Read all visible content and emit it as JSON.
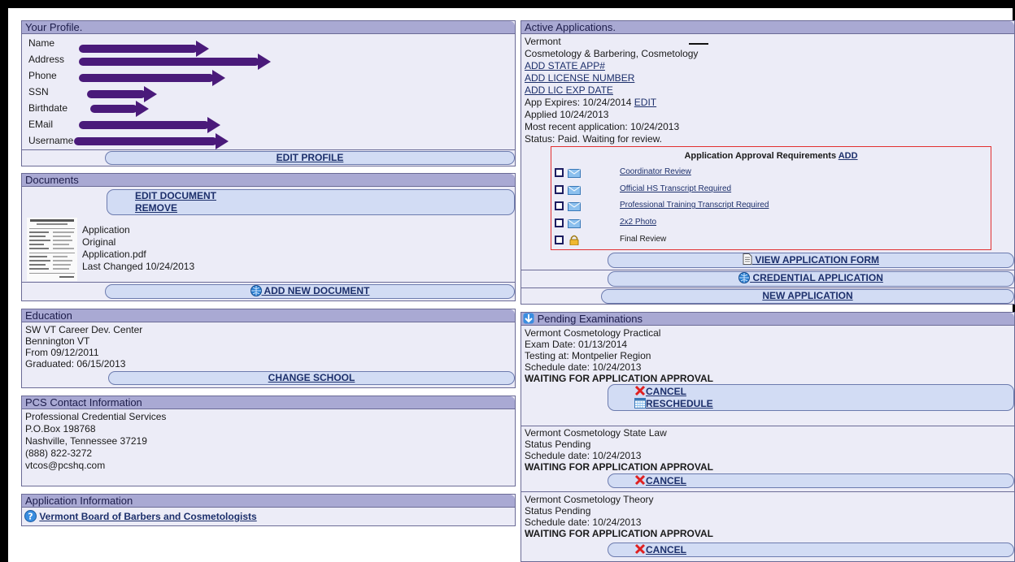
{
  "profile": {
    "title": "Your Profile.",
    "labels": {
      "name": "Name",
      "address": "Address",
      "phone": "Phone",
      "ssn": "SSN",
      "birthdate": "Birthdate",
      "email": "EMail",
      "username": "Username"
    },
    "edit_label": "EDIT PROFILE"
  },
  "documents": {
    "title": "Documents",
    "edit_label": "EDIT DOCUMENT",
    "remove_label": "REMOVE",
    "doc": {
      "name": "Application",
      "type": "Original",
      "file": "Application.pdf",
      "changed": "Last Changed 10/24/2013"
    },
    "add_label": "ADD NEW DOCUMENT"
  },
  "education": {
    "title": "Education",
    "school": "SW VT Career Dev. Center",
    "location": "Bennington VT",
    "from": "From 09/12/2011",
    "graduated": "Graduated: 06/15/2013",
    "change_label": "CHANGE SCHOOL"
  },
  "contact": {
    "title": "PCS Contact Information",
    "org": "Professional Credential Services",
    "pobox": "P.O.Box 198768",
    "city": "Nashville, Tennessee 37219",
    "phone": "(888) 822-3272",
    "email": "vtcos@pcshq.com"
  },
  "app_info": {
    "title": "Application Information",
    "link": "Vermont Board of Barbers and Cosmetologists"
  },
  "active": {
    "title": "Active Applications.",
    "state": "Vermont",
    "program": "Cosmetology & Barbering, Cosmetology",
    "add_state_app": "ADD STATE APP#",
    "add_license": "ADD LICENSE NUMBER",
    "add_lic_exp": "ADD LIC EXP DATE",
    "expires": "App Expires: 10/24/2014",
    "edit": "EDIT",
    "applied": "Applied 10/24/2013",
    "recent": "Most recent application: 10/24/2013",
    "status": "Status: Paid. Waiting for review.",
    "req_title": "Application Approval Requirements",
    "req_add": "ADD",
    "requirements": [
      {
        "label": "Coordinator Review",
        "icon": "envelope-icon"
      },
      {
        "label": "Official HS Transcript Required",
        "icon": "envelope-icon"
      },
      {
        "label": "Professional Training Transcript Required",
        "icon": "envelope-icon"
      },
      {
        "label": "2x2 Photo",
        "icon": "envelope-icon"
      },
      {
        "label": "Final Review",
        "icon": "lock-icon"
      }
    ],
    "view_form": "VIEW APPLICATION FORM",
    "credential": "CREDENTIAL APPLICATION",
    "new_app": "NEW APPLICATION"
  },
  "exams": {
    "title": "Pending Examinations",
    "items": [
      {
        "name": "Vermont Cosmetology Practical",
        "l2": "Exam Date: 01/13/2014",
        "l3": "Testing at: Montpelier Region",
        "l4": "Schedule date: 10/24/2013",
        "waiting": "WAITING FOR APPLICATION APPROVAL",
        "cancel": "CANCEL",
        "reschedule": "RESCHEDULE"
      },
      {
        "name": "Vermont Cosmetology State Law",
        "l2": "Status Pending",
        "l3": "Schedule date: 10/24/2013",
        "waiting": "WAITING FOR APPLICATION APPROVAL",
        "cancel": "CANCEL"
      },
      {
        "name": "Vermont Cosmetology Theory",
        "l2": "Status Pending",
        "l3": "Schedule date: 10/24/2013",
        "waiting": "WAITING FOR APPLICATION APPROVAL",
        "cancel": "CANCEL"
      }
    ]
  }
}
